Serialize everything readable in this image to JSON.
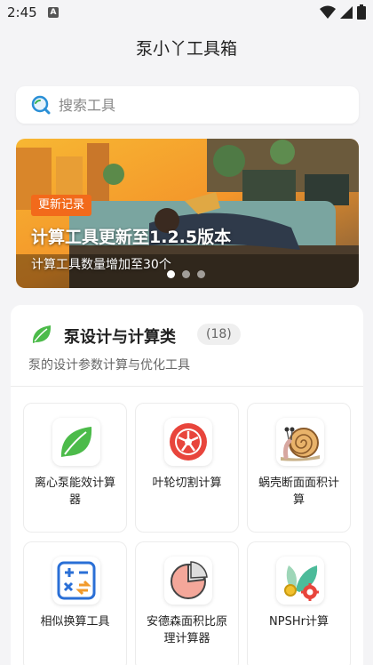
{
  "status_bar": {
    "time": "2:45",
    "notification_glyph": "A"
  },
  "header": {
    "title": "泵小丫工具箱"
  },
  "search": {
    "placeholder": "搜索工具"
  },
  "banner": {
    "tag": "更新记录",
    "title": "计算工具更新至1.2.5版本",
    "subtitle": "计算工具数量增加至30个",
    "slide_count": 3,
    "active_slide": 1
  },
  "category": {
    "title": "泵设计与计算类",
    "count": "(18)",
    "description": "泵的设计参数计算与优化工具",
    "tools": [
      {
        "label": "离心泵能效计算器",
        "icon": "leaf-icon"
      },
      {
        "label": "叶轮切割计算",
        "icon": "impeller-icon"
      },
      {
        "label": "蜗壳断面面积计算",
        "icon": "snail-icon"
      },
      {
        "label": "相似换算工具",
        "icon": "calculator-icon"
      },
      {
        "label": "安德森面积比原理计算器",
        "icon": "pie-chart-icon"
      },
      {
        "label": "NPSHr计算",
        "icon": "leaf-gear-icon"
      }
    ]
  },
  "colors": {
    "accent": "#f26a1b",
    "leaf": "#4cbb4a",
    "impeller": "#e8453c"
  }
}
